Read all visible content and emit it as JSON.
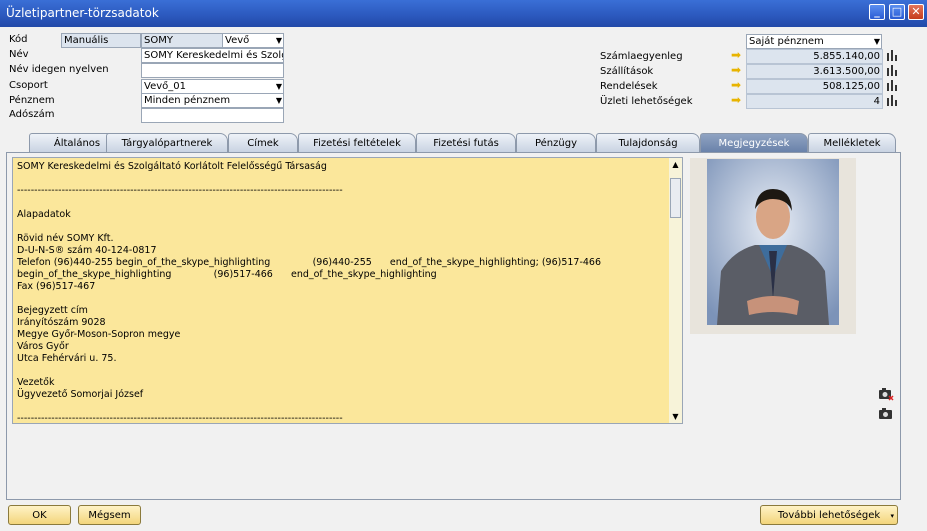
{
  "window": {
    "title": "Üzletipartner-törzsadatok"
  },
  "form": {
    "kod_label": "Kód",
    "kod_series": "Manuális",
    "kod_value": "SOMY",
    "kod_type": "Vevő",
    "nev_label": "Név",
    "nev_value": "SOMY Kereskedelmi és Szolgálta",
    "nev_idegen_label": "Név idegen nyelven",
    "nev_idegen_value": "",
    "csoport_label": "Csoport",
    "csoport_value": "Vevő_01",
    "penznem_label": "Pénznem",
    "penznem_value": "Minden pénznem",
    "adoszam_label": "Adószám",
    "adoszam_value": ""
  },
  "kpi": {
    "currency": "Saját pénznem",
    "rows": [
      {
        "label": "Számlaegyenleg",
        "value": "5.855.140,00"
      },
      {
        "label": "Szállítások",
        "value": "3.613.500,00"
      },
      {
        "label": "Rendelések",
        "value": "508.125,00"
      },
      {
        "label": "Üzleti lehetőségek",
        "value": "4"
      }
    ]
  },
  "tabs": [
    {
      "label": "Általános"
    },
    {
      "label": "Tárgyalópartnerek"
    },
    {
      "label": "Címek"
    },
    {
      "label": "Fizetési feltételek"
    },
    {
      "label": "Fizetési futás"
    },
    {
      "label": "Pénzügy"
    },
    {
      "label": "Tulajdonság"
    },
    {
      "label": "Megjegyzések",
      "active": true
    },
    {
      "label": "Mellékletek"
    }
  ],
  "notes": {
    "lines": [
      "SOMY Kereskedelmi és Szolgáltató Korlátolt Felelősségű Társaság",
      "",
      "-----------------------------------------------------------------------------------------------",
      "",
      "Alapadatok",
      "",
      "Rövid név SOMY Kft.",
      "D-U-N-S® szám 40-124-0817",
      "Telefon (96)440-255 begin_of_the_skype_highlighting              (96)440-255      end_of_the_skype_highlighting; (96)517-466",
      "begin_of_the_skype_highlighting              (96)517-466      end_of_the_skype_highlighting",
      "Fax (96)517-467",
      "",
      "Bejegyzett cím",
      "Irányítószám 9028",
      "Megye Győr-Moson-Sopron megye",
      "Város Győr",
      "Utca Fehérvári u. 75.",
      "",
      "Vezetők",
      "Ügyvezető Somorjai József",
      "",
      "-----------------------------------------------------------------------------------------------"
    ]
  },
  "buttons": {
    "ok": "OK",
    "cancel": "Mégsem",
    "more": "További lehetőségek"
  },
  "colors": {
    "title_bar": "#2b58bd",
    "notes_bg": "#fbe79b",
    "button_bg": "#f3d57c"
  }
}
